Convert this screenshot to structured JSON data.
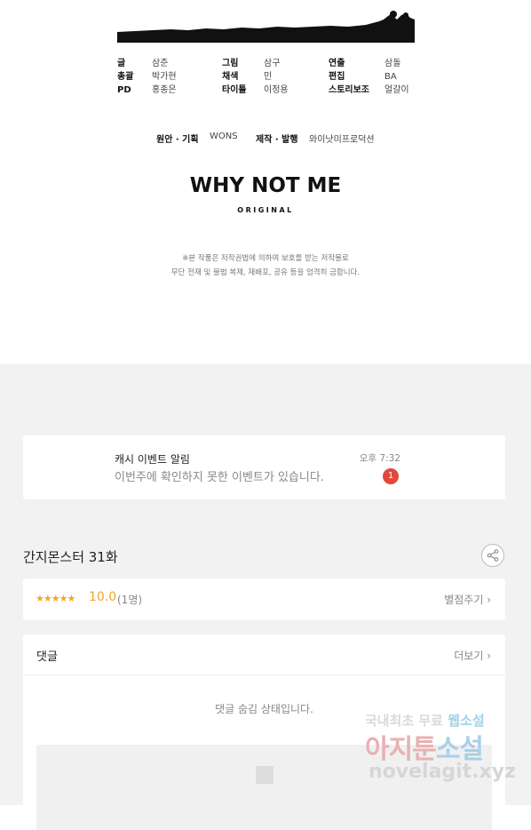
{
  "credits": {
    "columns": [
      {
        "rows": [
          {
            "role": "글",
            "name": "삼준"
          },
          {
            "role": "총괄",
            "name": "박가현"
          },
          {
            "role": "PD",
            "name": "홍종은"
          }
        ]
      },
      {
        "rows": [
          {
            "role": "그림",
            "name": "삼구"
          },
          {
            "role": "채색",
            "name": "민"
          },
          {
            "role": "타이틀",
            "name": "이정용"
          }
        ]
      },
      {
        "rows": [
          {
            "role": "연출",
            "name": "삼돌"
          },
          {
            "role": "편집",
            "name": "BA"
          },
          {
            "role": "스토리보조",
            "name": "얼갈이"
          }
        ]
      }
    ],
    "production": {
      "original_label": "원안 · 기획",
      "original_value": "WONS",
      "publish_label": "제작 · 발행",
      "publish_value": "와이낫미프로덕션"
    },
    "logo": "WHY NOT ME",
    "logo_sub": "ORIGINAL",
    "notice_line1": "※본 작품은 저작권법에 의하여 보호를 받는 저작물로",
    "notice_line2": "무단 전재 및 불법 복제, 재배포, 공유 등을 엄격히 금합니다."
  },
  "notification": {
    "title": "캐시 이벤트 알림",
    "body": "이번주에 확인하지 못한 이벤트가 있습니다.",
    "time": "오후 7:32",
    "badge": "1"
  },
  "episode": {
    "title": "간지몬스터 31화",
    "share_icon": "share-icon"
  },
  "rating": {
    "stars": "★★★★★",
    "score": "10.0",
    "count": "(1명)",
    "rate_link": "별점주기 ›"
  },
  "comments": {
    "title": "댓글",
    "more_link": "더보기 ›",
    "hidden_message": "댓글 숨김 상태입니다."
  },
  "watermark": {
    "line1_a": "국내최초 무료 ",
    "line1_b": "웹소설",
    "line2_a": "아지툰",
    "line2_b": "소설",
    "line3": "novelagit.xyz"
  },
  "colors": {
    "accent": "#f5a623",
    "badge": "#e2483a",
    "background": "#f2f2f2"
  }
}
